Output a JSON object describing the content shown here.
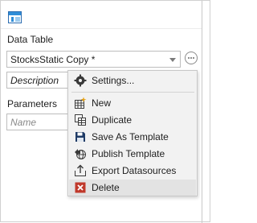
{
  "section": {
    "label": "Data Table"
  },
  "data_table": {
    "selected": "StocksStatic Copy *"
  },
  "description": {
    "placeholder": "Description"
  },
  "parameters": {
    "label": "Parameters"
  },
  "name": {
    "placeholder": "Name"
  },
  "menu": {
    "settings": "Settings...",
    "new": "New",
    "duplicate": "Duplicate",
    "save_as_template": "Save As Template",
    "publish_template": "Publish Template",
    "export_datasources": "Export Datasources",
    "delete": "Delete"
  },
  "icons": {
    "app": "panel-icon",
    "more": "ellipsis-circle-icon",
    "settings": "gear-icon",
    "new": "new-table-icon",
    "duplicate": "duplicate-icon",
    "save": "save-icon",
    "publish": "publish-icon",
    "export": "export-icon",
    "delete": "delete-icon"
  },
  "colors": {
    "accent": "#2f8ed8",
    "delete": "#c0392b",
    "menu_bg": "#f2f2f2",
    "highlight": "#e3e3e3"
  }
}
